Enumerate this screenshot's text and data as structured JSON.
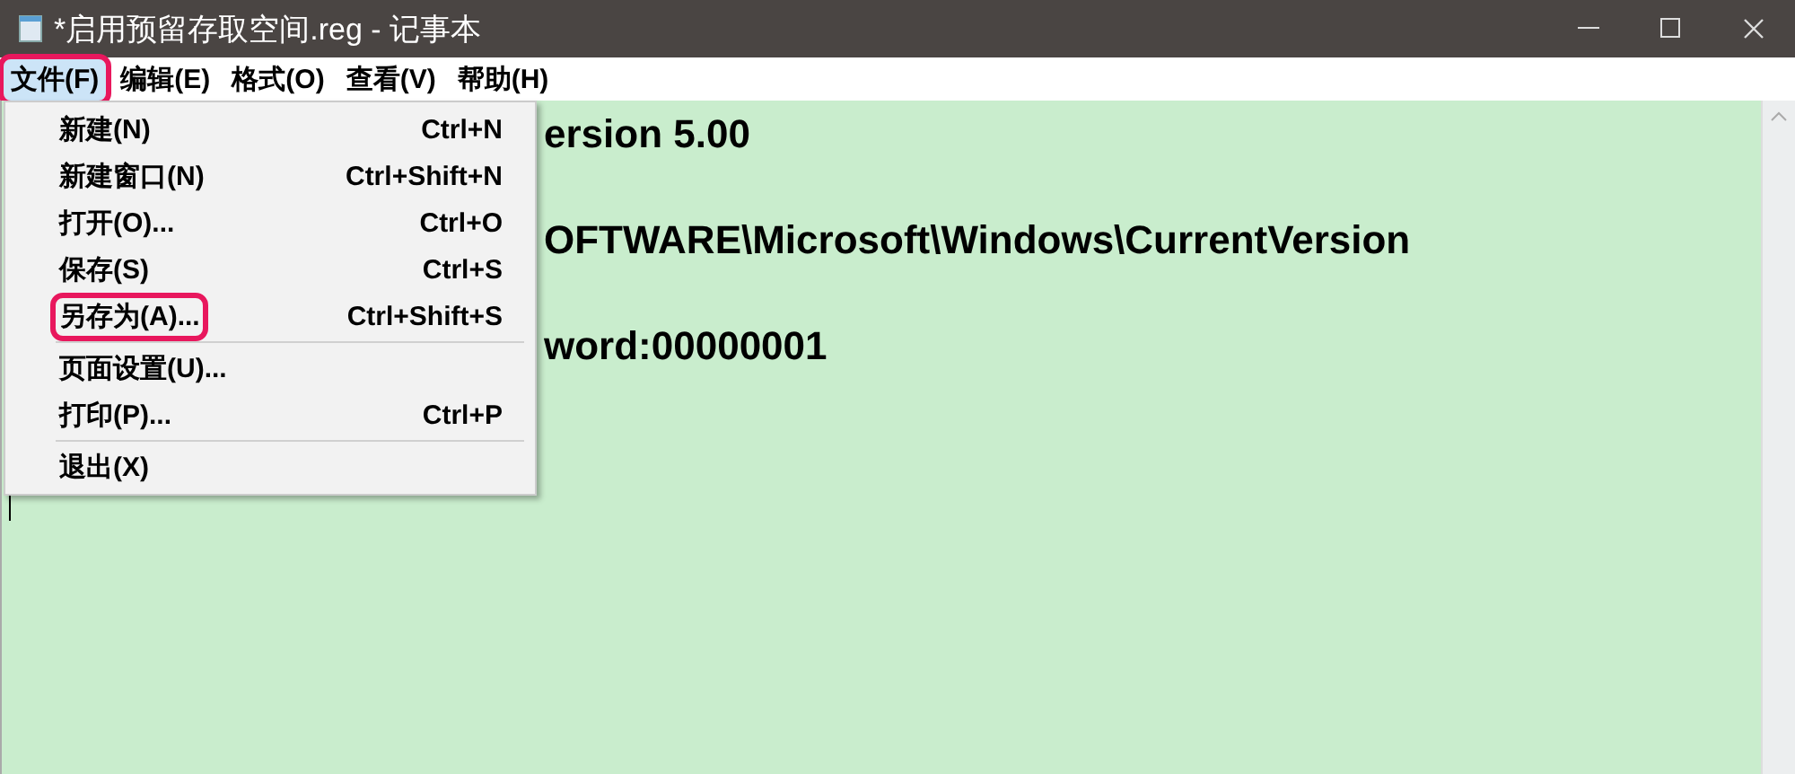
{
  "window": {
    "title": "*启用预留存取空间.reg - 记事本"
  },
  "menu_bar": [
    {
      "label": "文件(F)",
      "selected": true,
      "highlighted": true
    },
    {
      "label": "编辑(E)",
      "selected": false,
      "highlighted": false
    },
    {
      "label": "格式(O)",
      "selected": false,
      "highlighted": false
    },
    {
      "label": "查看(V)",
      "selected": false,
      "highlighted": false
    },
    {
      "label": "帮助(H)",
      "selected": false,
      "highlighted": false
    }
  ],
  "file_menu": [
    {
      "kind": "item",
      "label": "新建(N)",
      "shortcut": "Ctrl+N",
      "highlighted": false
    },
    {
      "kind": "item",
      "label": "新建窗口(N)",
      "shortcut": "Ctrl+Shift+N",
      "highlighted": false
    },
    {
      "kind": "item",
      "label": "打开(O)...",
      "shortcut": "Ctrl+O",
      "highlighted": false
    },
    {
      "kind": "item",
      "label": "保存(S)",
      "shortcut": "Ctrl+S",
      "highlighted": false
    },
    {
      "kind": "item",
      "label": "另存为(A)...",
      "shortcut": "Ctrl+Shift+S",
      "highlighted": true
    },
    {
      "kind": "separator"
    },
    {
      "kind": "item",
      "label": "页面设置(U)...",
      "highlighted": false
    },
    {
      "kind": "item",
      "label": "打印(P)...",
      "shortcut": "Ctrl+P",
      "highlighted": false
    },
    {
      "kind": "separator"
    },
    {
      "kind": "item",
      "label": "退出(X)",
      "highlighted": false
    }
  ],
  "editor": {
    "lines": [
      "ersion 5.00",
      "OFTWARE\\Microsoft\\Windows\\CurrentVersion",
      "word:00000001"
    ]
  }
}
